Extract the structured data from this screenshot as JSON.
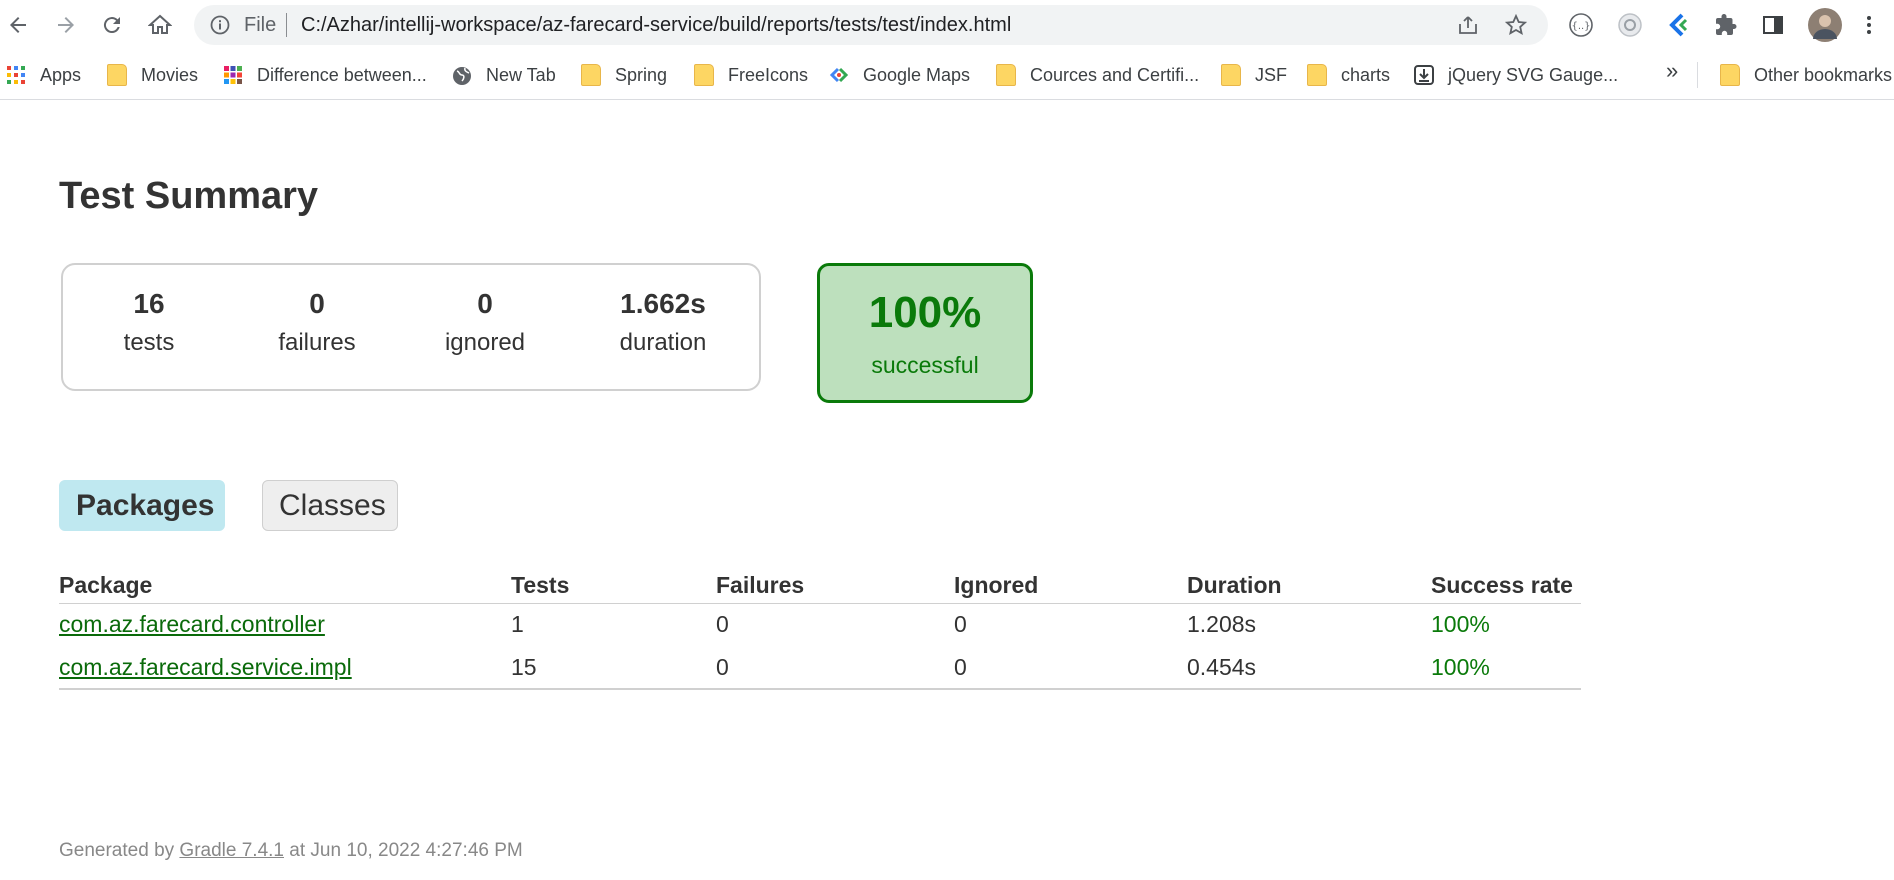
{
  "browser": {
    "omnibox_scheme": "File",
    "url": "C:/Azhar/intellij-workspace/az-farecard-service/build/reports/tests/test/index.html"
  },
  "bookmarks": [
    {
      "label": "Apps",
      "icon": "apps-grid-icon"
    },
    {
      "label": "Movies",
      "icon": "folder-icon"
    },
    {
      "label": "Difference between...",
      "icon": "colorful-grid-icon"
    },
    {
      "label": "New Tab",
      "icon": "globe-icon"
    },
    {
      "label": "Spring",
      "icon": "folder-icon"
    },
    {
      "label": "FreeIcons",
      "icon": "folder-icon"
    },
    {
      "label": "Google Maps",
      "icon": "maps-icon"
    },
    {
      "label": "Cources and Certifi...",
      "icon": "folder-icon"
    },
    {
      "label": "JSF",
      "icon": "folder-icon"
    },
    {
      "label": "charts",
      "icon": "folder-icon"
    },
    {
      "label": "jQuery SVG Gauge...",
      "icon": "download-icon"
    }
  ],
  "bookmarks_more": "»",
  "other_bookmarks": "Other bookmarks",
  "page": {
    "title": "Test Summary",
    "counters": [
      {
        "value": "16",
        "label": "tests"
      },
      {
        "value": "0",
        "label": "failures"
      },
      {
        "value": "0",
        "label": "ignored"
      },
      {
        "value": "1.662s",
        "label": "duration"
      }
    ],
    "success": {
      "value": "100%",
      "label": "successful"
    },
    "tabs": [
      {
        "label": "Packages",
        "active": true
      },
      {
        "label": "Classes",
        "active": false
      }
    ],
    "table": {
      "headers": [
        "Package",
        "Tests",
        "Failures",
        "Ignored",
        "Duration",
        "Success rate"
      ],
      "rows": [
        {
          "package": "com.az.farecard.controller",
          "tests": "1",
          "failures": "0",
          "ignored": "0",
          "duration": "1.208s",
          "success_rate": "100%"
        },
        {
          "package": "com.az.farecard.service.impl",
          "tests": "15",
          "failures": "0",
          "ignored": "0",
          "duration": "0.454s",
          "success_rate": "100%"
        }
      ]
    },
    "footer": {
      "prefix": "Generated by",
      "link": "Gradle 7.4.1",
      "suffix": "at Jun 10, 2022 4:27:46 PM"
    }
  },
  "colors": {
    "success_green": "#0a7a0a",
    "success_bg": "#bde0bd",
    "active_tab_bg": "#bfe8f0"
  }
}
